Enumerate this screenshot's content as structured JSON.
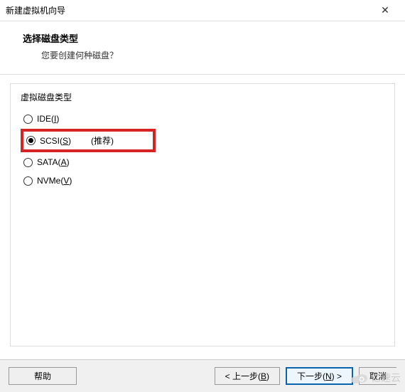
{
  "window": {
    "title": "新建虚拟机向导",
    "close_icon": "✕"
  },
  "header": {
    "title": "选择磁盘类型",
    "subtitle": "您要创建何种磁盘？"
  },
  "group": {
    "label": "虚拟磁盘类型",
    "options": [
      {
        "id": "ide",
        "pre": "IDE(",
        "hot": "I",
        "post": ")",
        "checked": false,
        "suffix": ""
      },
      {
        "id": "scsi",
        "pre": "SCSI(",
        "hot": "S",
        "post": ")",
        "checked": true,
        "suffix": "(推荐)"
      },
      {
        "id": "sata",
        "pre": "SATA(",
        "hot": "A",
        "post": ")",
        "checked": false,
        "suffix": ""
      },
      {
        "id": "nvme",
        "pre": "NVMe(",
        "hot": "V",
        "post": ")",
        "checked": false,
        "suffix": ""
      }
    ]
  },
  "buttons": {
    "help": "帮助",
    "back_pre": "< 上一步(",
    "back_hot": "B",
    "back_post": ")",
    "next_pre": "下一步(",
    "next_hot": "N",
    "next_post": ") >",
    "cancel": "取消"
  },
  "watermark": {
    "text": "亿速云"
  }
}
